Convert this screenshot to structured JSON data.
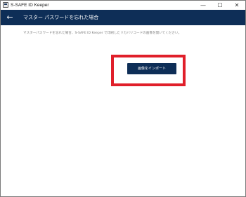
{
  "window": {
    "title": "S-SAFE ID Keeper",
    "controls": {
      "minimize": "—",
      "maximize": "☐",
      "close": "✕"
    }
  },
  "header": {
    "back_icon": "←",
    "title": "マスター パスワードを忘れた場合"
  },
  "main": {
    "description": "マスターパスワードを忘れた場合、S-SAFE ID Keeper で印刷したリカバリコードの画像を開いてください。",
    "import_button_label": "画像をインポート",
    "highlight_color": "#e01f2a",
    "accent_color": "#0e2e57"
  }
}
